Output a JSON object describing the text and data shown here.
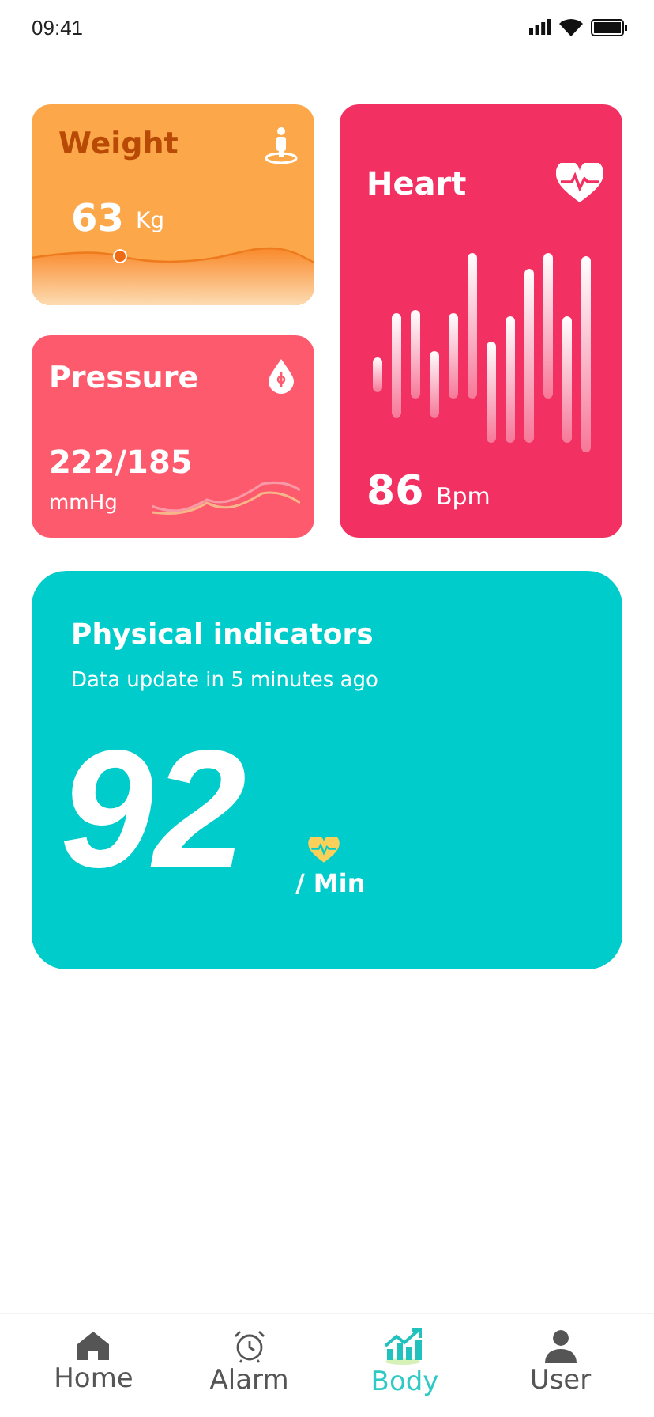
{
  "status_bar": {
    "time": "09:41"
  },
  "weight": {
    "title": "Weight",
    "value": "63",
    "unit": "Kg"
  },
  "pressure": {
    "title": "Pressure",
    "value": "222/185",
    "unit": "mmHg"
  },
  "heart": {
    "title": "Heart",
    "value": "86",
    "unit": "Bpm"
  },
  "indicators": {
    "title": "Physical indicators",
    "subtitle": "Data update in 5 minutes ago",
    "value": "92",
    "unit": "/ Min"
  },
  "tabs": [
    {
      "kind": "home",
      "label": "Home",
      "selected": false
    },
    {
      "kind": "alarm",
      "label": "Alarm",
      "selected": false
    },
    {
      "kind": "body",
      "label": "Body",
      "selected": true
    },
    {
      "kind": "user",
      "label": "User",
      "selected": false
    }
  ]
}
